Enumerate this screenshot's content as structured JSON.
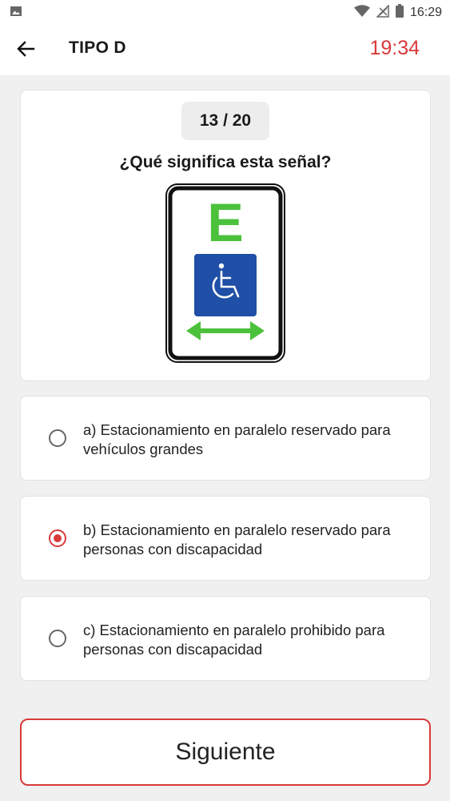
{
  "status_bar": {
    "time": "16:29",
    "icons": [
      "image-icon",
      "wifi-icon",
      "signal-icon",
      "battery-icon"
    ]
  },
  "header": {
    "title": "TIPO D",
    "timer": "19:34",
    "back_icon": "back-arrow-icon"
  },
  "question": {
    "counter": "13 / 20",
    "text": "¿Qué significa esta señal?",
    "sign": {
      "letter": "E",
      "colors": {
        "letter": "#4cc13c",
        "arrow": "#4cc13c",
        "panel": "#1f4fa6"
      }
    }
  },
  "options": [
    {
      "text": "a) Estacionamiento en paralelo reservado para vehículos grandes",
      "selected": false
    },
    {
      "text": "b) Estacionamiento en paralelo reservado para personas con discapacidad",
      "selected": true
    },
    {
      "text": "c) Estacionamiento en paralelo prohibido para personas con discapacidad",
      "selected": false
    }
  ],
  "next_button": {
    "label": "Siguiente"
  },
  "colors": {
    "accent": "#d83a3a",
    "background": "#f0f0f0",
    "card": "#ffffff"
  }
}
